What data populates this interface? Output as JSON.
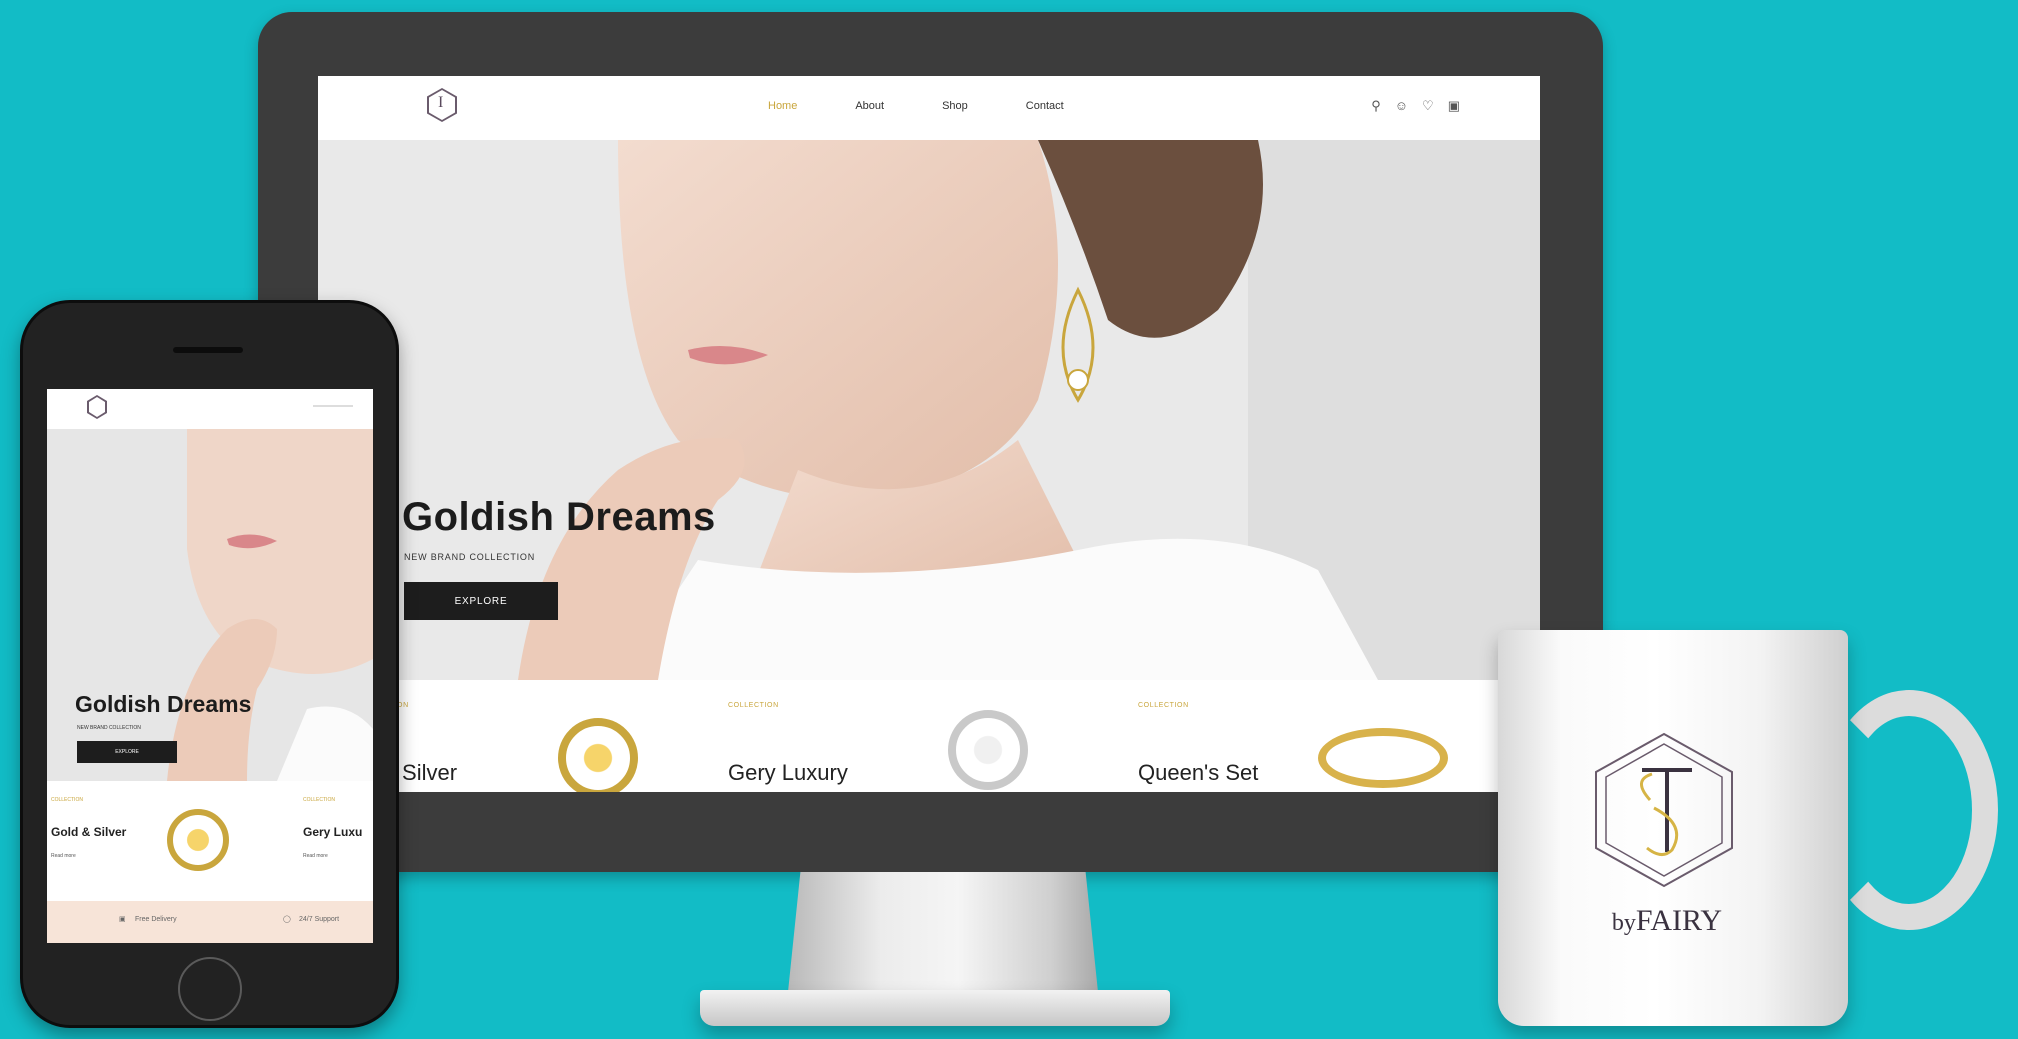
{
  "desktop": {
    "logo": {
      "icon": "hexagon-fs-logo-icon"
    },
    "nav": [
      {
        "label": "Home",
        "active": true
      },
      {
        "label": "About",
        "active": false
      },
      {
        "label": "Shop",
        "active": false
      },
      {
        "label": "Contact",
        "active": false
      }
    ],
    "header_icons": [
      "search-icon",
      "user-icon",
      "heart-icon",
      "bag-icon"
    ],
    "hero": {
      "title": "Goldish Dreams",
      "subtitle": "NEW BRAND COLLECTION",
      "button": "EXPLORE"
    },
    "collections": [
      {
        "tag": "COLLECTION",
        "name": "ld & Silver"
      },
      {
        "tag": "COLLECTION",
        "name": "Gery Luxury"
      },
      {
        "tag": "COLLECTION",
        "name": "Queen's Set"
      }
    ]
  },
  "mobile": {
    "hero": {
      "title": "Goldish Dreams",
      "subtitle": "NEW BRAND COLLECTION",
      "button": "EXPLORE"
    },
    "collections": [
      {
        "tag": "COLLECTION",
        "name": "Gold & Silver",
        "link": "Read more"
      },
      {
        "tag": "COLLECTION",
        "name": "Gery Luxu",
        "link": "Read more"
      }
    ],
    "features": [
      {
        "icon": "truck-icon",
        "label": "Free Delivery"
      },
      {
        "icon": "chat-icon",
        "label": "24/7 Support"
      }
    ]
  },
  "mug": {
    "brand_by": "by",
    "brand_name": "FAIRY"
  },
  "colors": {
    "background": "#12bcc6",
    "accent_gold": "#c9a63d",
    "button_dark": "#1d1d1d"
  }
}
